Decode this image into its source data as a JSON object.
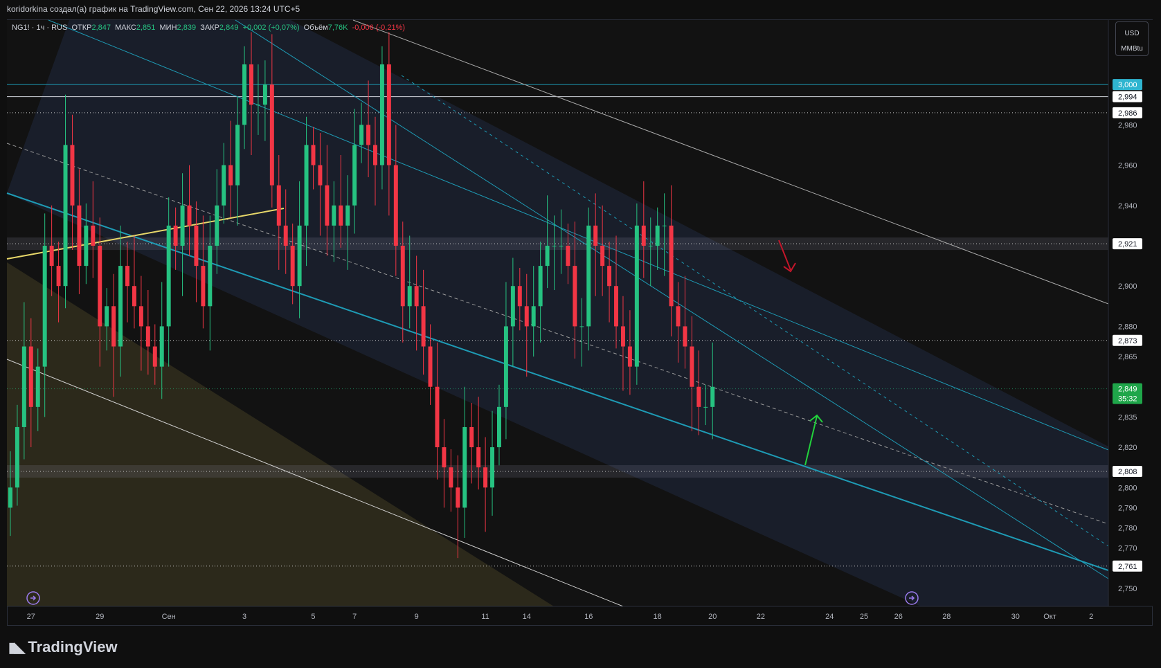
{
  "header": {
    "caption": "koridorkina создал(а) график на TradingView.com, Сен 22, 2026 13:24 UTC+5"
  },
  "legend": {
    "symbol": "NG1! · 1ч · RUS",
    "open_label": "ОТКР",
    "open": "2,847",
    "high_label": "МАКС",
    "high": "2,851",
    "low_label": "МИН",
    "low": "2,839",
    "close_label": "ЗАКР",
    "close": "2,849",
    "change": "+0,002 (+0,07%)",
    "volume_label": "Объём",
    "volume": "7,76K",
    "volume_change": "-0,006 (-0,21%)"
  },
  "units": {
    "currency": "USD",
    "unit": "MMBtu"
  },
  "brand": {
    "name": "TradingView"
  },
  "colors": {
    "bg": "#0f0f0f",
    "up": "#26c281",
    "down": "#f23645",
    "channel": "#1e9bb5",
    "yellow_line": "#e8d86a",
    "label_cyan": "#2fb5d0",
    "label_green": "#1fa64a"
  },
  "chart_data": {
    "type": "candlestick",
    "timeframe": "1ч",
    "y_axis": {
      "ylim": [
        2.741,
        3.032
      ],
      "ticks": [
        "2,980",
        "2,960",
        "2,940",
        "2,900",
        "2,880",
        "2,865",
        "2,835",
        "2,820",
        "2,800",
        "2,790",
        "2,780",
        "2,770",
        "2,750"
      ],
      "tick_values": [
        2.98,
        2.96,
        2.94,
        2.9,
        2.88,
        2.865,
        2.835,
        2.82,
        2.8,
        2.79,
        2.78,
        2.77,
        2.75
      ]
    },
    "x_axis": {
      "ticks": [
        "27",
        "29",
        "Сен",
        "3",
        "5",
        "7",
        "9",
        "11",
        "14",
        "16",
        "18",
        "20",
        "22",
        "24",
        "25",
        "26",
        "28",
        "30",
        "Окт",
        "2"
      ],
      "tick_index": [
        3,
        13,
        23,
        34,
        44,
        50,
        59,
        69,
        75,
        84,
        94,
        102,
        109,
        119,
        124,
        129,
        136,
        146,
        151,
        157
      ]
    },
    "price_labels": [
      {
        "text": "3,000",
        "value": 3.0,
        "style": "cyan"
      },
      {
        "text": "2,994",
        "value": 2.994,
        "style": "white"
      },
      {
        "text": "2,986",
        "value": 2.986,
        "style": "white"
      },
      {
        "text": "2,921",
        "value": 2.921,
        "style": "white"
      },
      {
        "text": "2,873",
        "value": 2.873,
        "style": "white"
      },
      {
        "text": "2,808",
        "value": 2.808,
        "style": "white"
      },
      {
        "text": "2,761",
        "value": 2.761,
        "style": "white"
      }
    ],
    "current_price": {
      "text": "2,849",
      "timer": "35:32",
      "value": 2.849
    },
    "levels": [
      {
        "value": 3.0,
        "style": "solid-cyan"
      },
      {
        "value": 2.994,
        "style": "solid-white"
      },
      {
        "value": 2.986,
        "style": "dotted"
      },
      {
        "value": 2.921,
        "style": "dotted-zone"
      },
      {
        "value": 2.873,
        "style": "dotted"
      },
      {
        "value": 2.808,
        "style": "dotted-zone"
      },
      {
        "value": 2.761,
        "style": "dotted"
      }
    ],
    "candles_close": [
      2.8,
      2.83,
      2.87,
      2.84,
      2.86,
      2.92,
      2.91,
      2.9,
      2.97,
      2.94,
      2.91,
      2.93,
      2.92,
      2.88,
      2.89,
      2.87,
      2.91,
      2.9,
      2.89,
      2.88,
      2.87,
      2.86,
      2.88,
      2.93,
      2.92,
      2.94,
      2.93,
      2.91,
      2.89,
      2.92,
      2.94,
      2.96,
      2.95,
      2.98,
      3.01,
      2.99,
      2.99,
      3.0,
      2.95,
      2.93,
      2.92,
      2.9,
      2.93,
      2.97,
      2.96,
      2.95,
      2.93,
      2.94,
      2.93,
      2.94,
      2.97,
      2.98,
      2.97,
      2.96,
      3.01,
      2.96,
      2.92,
      2.89,
      2.9,
      2.89,
      2.87,
      2.85,
      2.82,
      2.81,
      2.8,
      2.79,
      2.83,
      2.82,
      2.81,
      2.8,
      2.82,
      2.84,
      2.88,
      2.9,
      2.89,
      2.88,
      2.89,
      2.91,
      2.92,
      2.92,
      2.92,
      2.91,
      2.88,
      2.88,
      2.93,
      2.92,
      2.91,
      2.9,
      2.88,
      2.87,
      2.86,
      2.93,
      2.92,
      2.92,
      2.93,
      2.93,
      2.89,
      2.88,
      2.87,
      2.85,
      2.84,
      2.84,
      2.85
    ],
    "annotations": [
      {
        "type": "arrow",
        "color": "red",
        "direction": "down"
      },
      {
        "type": "arrow",
        "color": "green",
        "direction": "up"
      }
    ]
  }
}
